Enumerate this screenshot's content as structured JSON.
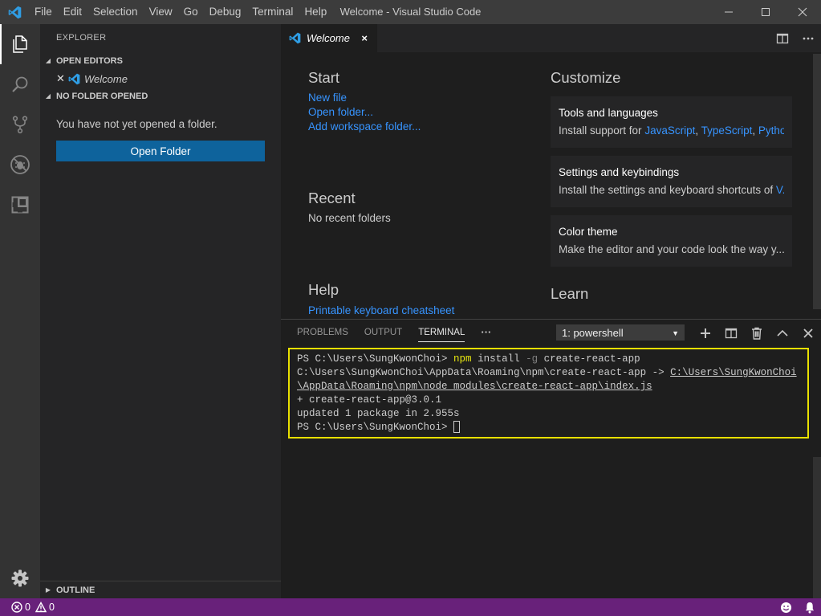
{
  "window": {
    "title": "Welcome - Visual Studio Code",
    "menu": [
      "File",
      "Edit",
      "Selection",
      "View",
      "Go",
      "Debug",
      "Terminal",
      "Help"
    ]
  },
  "activity_bar": {
    "items": [
      "explorer-icon",
      "search-icon",
      "source-control-icon",
      "debug-icon",
      "extensions-icon"
    ],
    "settings_icon": "gear-icon"
  },
  "sidebar": {
    "title": "EXPLORER",
    "open_editors": {
      "header": "OPEN EDITORS",
      "items": [
        {
          "label": "Welcome"
        }
      ]
    },
    "no_folder": {
      "header": "NO FOLDER OPENED",
      "message": "You have not yet opened a folder.",
      "button": "Open Folder"
    },
    "outline": {
      "header": "OUTLINE"
    }
  },
  "tabs": [
    {
      "label": "Welcome",
      "close": "×"
    }
  ],
  "welcome": {
    "start": {
      "heading": "Start",
      "links": [
        "New file",
        "Open folder...",
        "Add workspace folder..."
      ]
    },
    "recent": {
      "heading": "Recent",
      "text": "No recent folders"
    },
    "help": {
      "heading": "Help",
      "links": [
        "Printable keyboard cheatsheet"
      ]
    },
    "customize": {
      "heading": "Customize",
      "cards": [
        {
          "title": "Tools and languages",
          "desc_prefix": "Install support for ",
          "links": [
            "JavaScript",
            "TypeScript",
            "Pytho..."
          ]
        },
        {
          "title": "Settings and keybindings",
          "desc_prefix": "Install the settings and keyboard shortcuts of ",
          "links": [
            "V..."
          ]
        },
        {
          "title": "Color theme",
          "desc_prefix": "Make the editor and your code look the way y...",
          "links": []
        }
      ]
    },
    "learn": {
      "heading": "Learn"
    }
  },
  "panel": {
    "tabs": [
      "PROBLEMS",
      "OUTPUT",
      "TERMINAL"
    ],
    "active_tab": "TERMINAL",
    "more": "···",
    "terminal_select": "1: powershell",
    "terminal": {
      "line1": {
        "prompt": "PS C:\\Users\\SungKwonChoi> ",
        "cmd": "npm",
        "mid": " install ",
        "flag": "-g",
        "rest": " create-react-app"
      },
      "line2": {
        "text": "C:\\Users\\SungKwonChoi\\AppData\\Roaming\\npm\\create-react-app -> ",
        "link": "C:\\Users\\SungKwonChoi\\AppData\\Roaming\\npm\\node_modules\\create-react-app\\index.js"
      },
      "line3": "+ create-react-app@3.0.1",
      "line4": "updated 1 package in 2.955s",
      "line5": "PS C:\\Users\\SungKwonChoi> "
    }
  },
  "statusbar": {
    "errors": "0",
    "warnings": "0"
  },
  "colors": {
    "statusbar": "#68217a",
    "accent_button": "#0e639c",
    "link": "#3794ff",
    "terminal_highlight": "#e8e000"
  }
}
